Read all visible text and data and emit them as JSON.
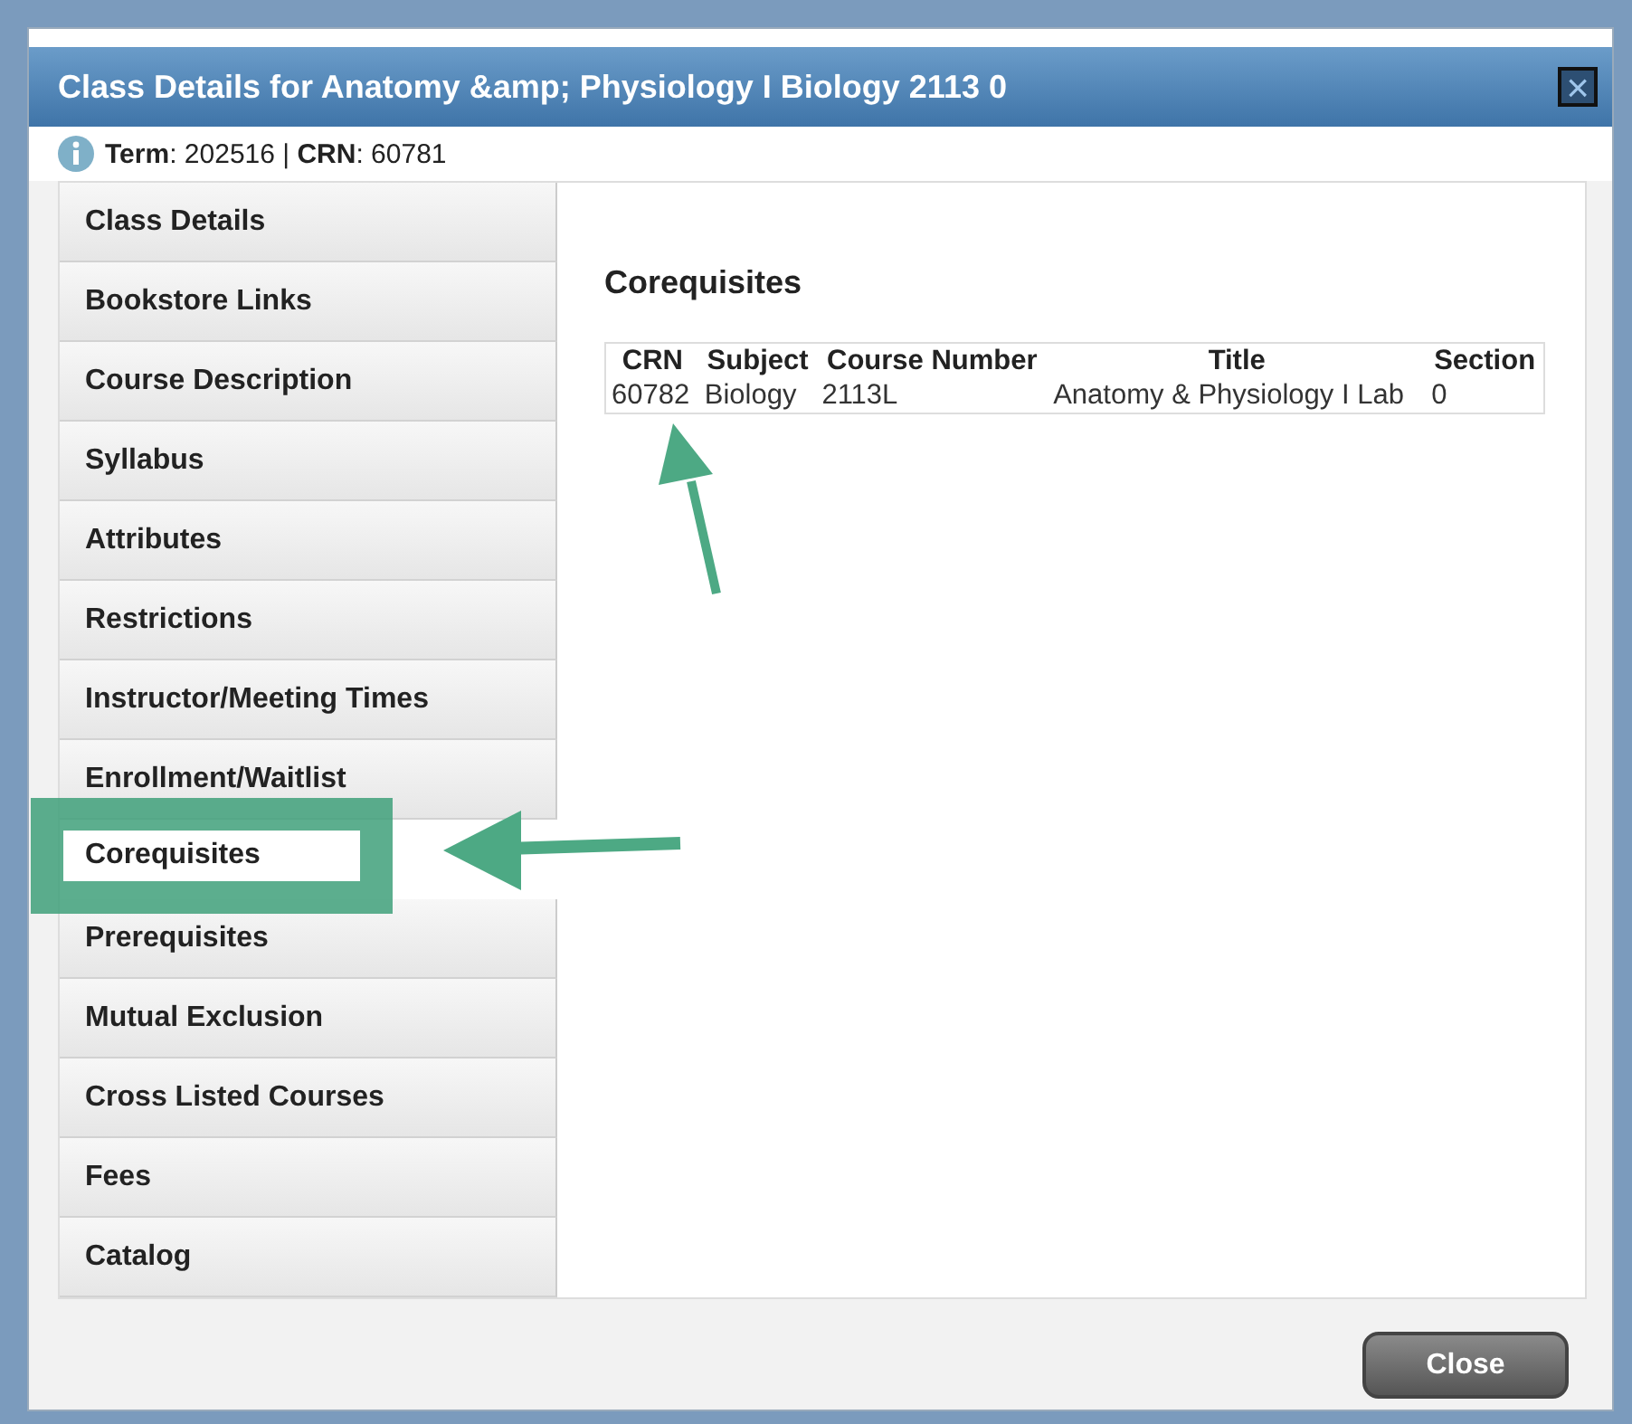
{
  "window": {
    "title": "Class Details for Anatomy &amp; Physiology I Biology 2113 0",
    "close_icon": "×"
  },
  "info": "**Term**: 202516 | **CRN**: 60781",
  "sidebar": {
    "items": [
      {
        "label": "Class Details",
        "selected": false
      },
      {
        "label": "Bookstore Links",
        "selected": false
      },
      {
        "label": "Course Description",
        "selected": false
      },
      {
        "label": "Syllabus",
        "selected": false
      },
      {
        "label": "Attributes",
        "selected": false
      },
      {
        "label": "Restrictions",
        "selected": false
      },
      {
        "label": "Instructor/Meeting Times",
        "selected": false
      },
      {
        "label": "Enrollment/Waitlist",
        "selected": false
      },
      {
        "label": "Corequisites",
        "selected": true
      },
      {
        "label": "Prerequisites",
        "selected": false
      },
      {
        "label": "Mutual Exclusion",
        "selected": false
      },
      {
        "label": "Cross Listed Courses",
        "selected": false
      },
      {
        "label": "Fees",
        "selected": false
      },
      {
        "label": "Catalog",
        "selected": false
      }
    ]
  },
  "content": {
    "heading": "Corequisites",
    "table": {
      "columns": [
        "CRN",
        "Subject",
        "Course Number",
        "Title",
        "Section"
      ],
      "rows": [
        [
          "60782",
          "Biology",
          "2113L",
          "Anatomy & Physiology I Lab",
          "0"
        ]
      ]
    }
  },
  "footer": {
    "buttons": [
      "Close"
    ]
  }
}
